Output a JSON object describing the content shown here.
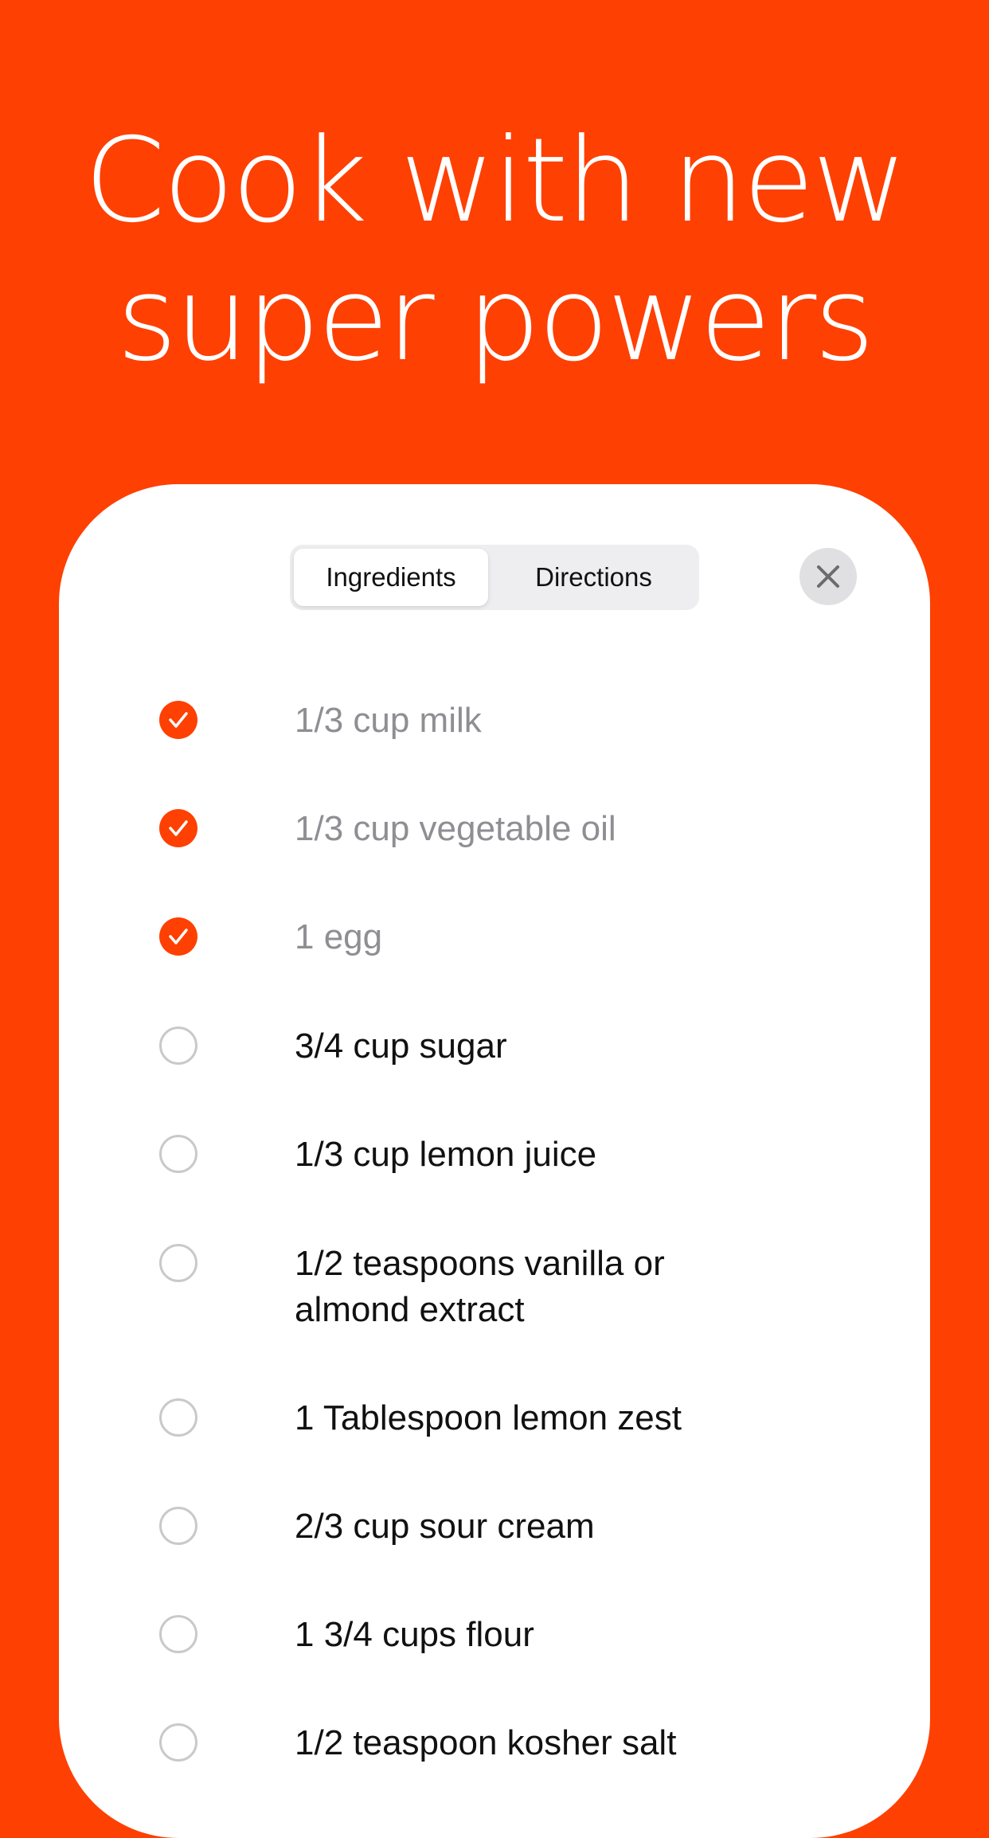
{
  "headline": {
    "line1": "Cook with new",
    "line2": "super powers"
  },
  "colors": {
    "accent": "#FE4002",
    "checked_text": "#8E8E93",
    "text": "#111111"
  },
  "tabs": {
    "ingredients": "Ingredients",
    "directions": "Directions",
    "selected": "Ingredients"
  },
  "close_icon": "close-icon",
  "ingredients": [
    {
      "text": "1/3 cup milk",
      "checked": true
    },
    {
      "text": "1/3 cup vegetable oil",
      "checked": true
    },
    {
      "text": "1 egg",
      "checked": true
    },
    {
      "text": "3/4 cup sugar",
      "checked": false
    },
    {
      "text": "1/3 cup lemon juice",
      "checked": false
    },
    {
      "text": "1/2 teaspoons vanilla or almond extract",
      "checked": false
    },
    {
      "text": "1 Tablespoon lemon zest",
      "checked": false
    },
    {
      "text": "2/3 cup sour cream",
      "checked": false
    },
    {
      "text": "1 3/4 cups flour",
      "checked": false
    },
    {
      "text": "1/2 teaspoon kosher salt",
      "checked": false
    }
  ]
}
